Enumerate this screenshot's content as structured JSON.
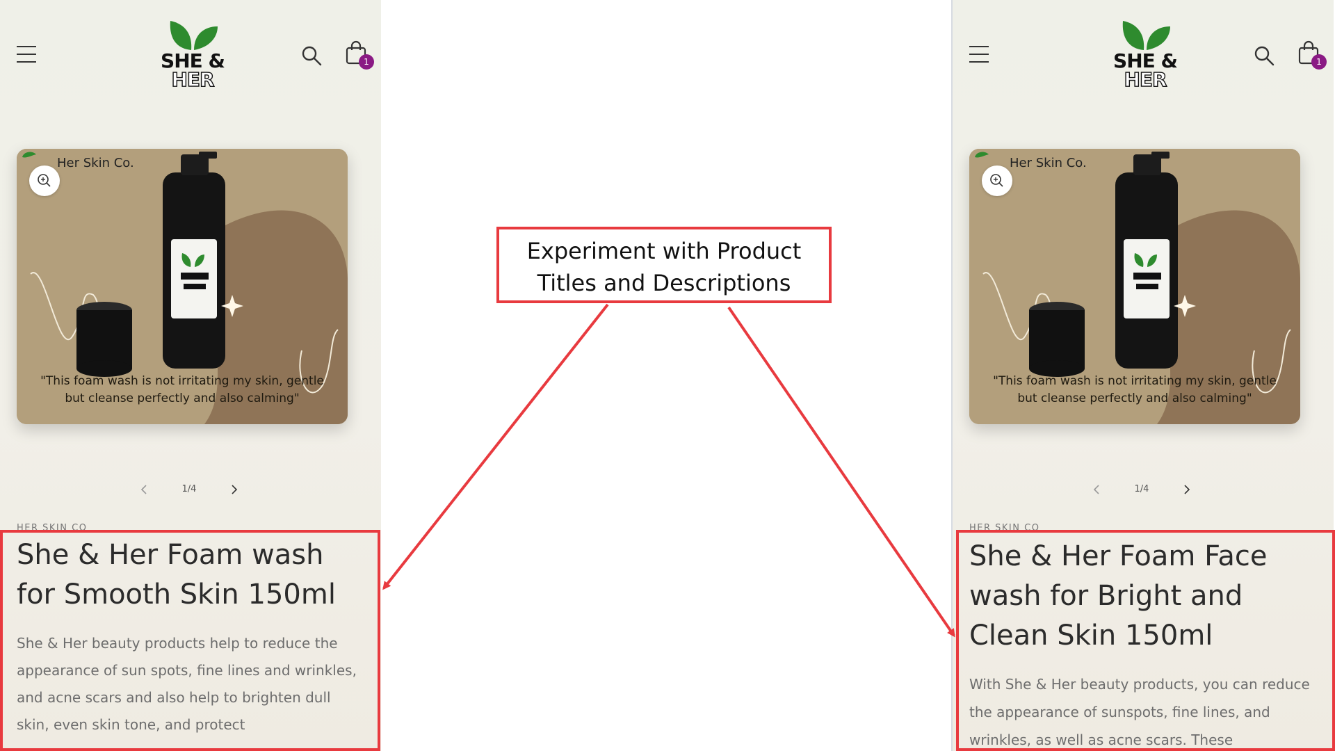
{
  "callout": {
    "text": "Experiment with Product Titles and Descriptions",
    "border_color": "#e83a3f"
  },
  "logo": {
    "line1": "SHE &",
    "line2": "HER",
    "leaf_color": "#2e8b2e"
  },
  "icons": {
    "menu": "hamburger-menu-icon",
    "search": "search-icon",
    "cart": "shopping-bag-icon",
    "zoom": "zoom-in-icon",
    "prev": "chevron-left-icon",
    "next": "chevron-right-icon"
  },
  "colors": {
    "badge": "#8a1a84",
    "card_bg": "#b39f7c",
    "highlight": "#e83a3f"
  },
  "variant_a": {
    "cart_count": "1",
    "image_brand": "Her Skin Co.",
    "image_quote": "\"This foam wash is not irritating my skin, gentle but cleanse perfectly and also calming\"",
    "pager": "1/4",
    "vendor": "HER SKIN CO",
    "title": "She & Her Foam wash for Smooth Skin 150ml",
    "description": "She & Her beauty products help to reduce the appearance of sun spots, fine lines and wrinkles, and acne scars and also help to brighten dull skin, even skin tone, and protect"
  },
  "variant_b": {
    "cart_count": "1",
    "image_brand": "Her Skin Co.",
    "image_quote": "\"This foam wash is not irritating my skin, gentle but cleanse perfectly and also calming\"",
    "pager": "1/4",
    "vendor": "HER SKIN CO",
    "title": "She & Her Foam Face wash for Bright and Clean Skin 150ml",
    "description": "With She & Her beauty products, you can reduce the appearance of sunspots, fine lines, and wrinkles, as well as acne scars. These"
  }
}
